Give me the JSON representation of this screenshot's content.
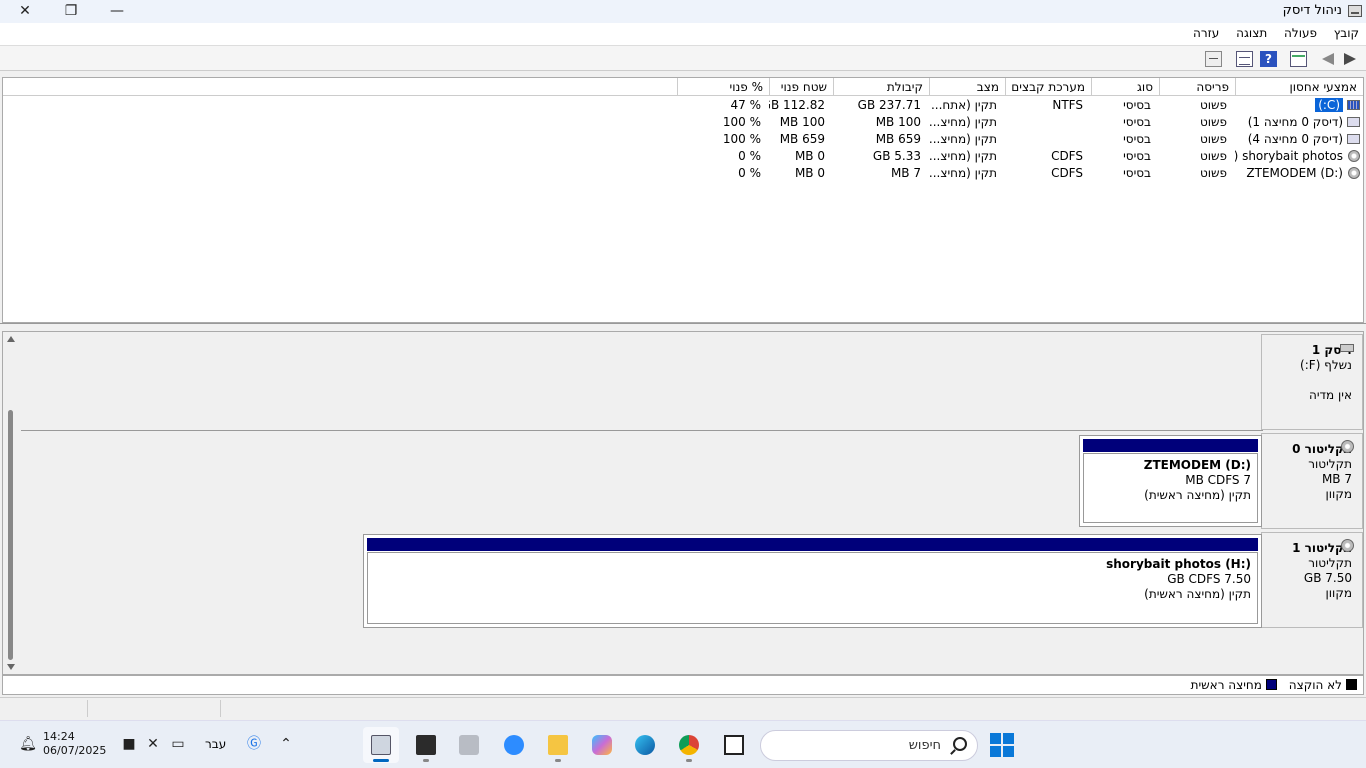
{
  "window": {
    "title": "ניהול דיסק",
    "close_glyph": "✕",
    "max_glyph": "❐",
    "min_glyph": "—"
  },
  "menu": [
    "קובץ",
    "פעולה",
    "תצוגה",
    "עזרה"
  ],
  "toolbar": {
    "help_glyph": "?"
  },
  "volume_list": {
    "columns": [
      "אמצעי אחסון",
      "פריסה",
      "סוג",
      "מערכת קבצים",
      "מצב",
      "קיבולת",
      "שטח פנוי",
      "% פנוי"
    ],
    "rows": [
      {
        "volume": "(C:)",
        "layout": "פשוט",
        "type": "בסיסי",
        "fs": "NTFS",
        "status": "תקין (אתח...",
        "capacity": "GB 237.71",
        "free": "GB 112.82",
        "pct": "% 47",
        "icon": "system-drive-icon",
        "selected": true
      },
      {
        "volume": "(דיסק 0 מחיצה 1)",
        "layout": "פשוט",
        "type": "בסיסי",
        "fs": "",
        "status": "תקין (מחיצ...",
        "capacity": "MB 100",
        "free": "MB 100",
        "pct": "% 100",
        "icon": "drive-icon"
      },
      {
        "volume": "(דיסק 0 מחיצה 4)",
        "layout": "פשוט",
        "type": "בסיסי",
        "fs": "",
        "status": "תקין (מחיצ...",
        "capacity": "MB 659",
        "free": "MB 659",
        "pct": "% 100",
        "icon": "drive-icon"
      },
      {
        "volume": "shorybait photos (...",
        "layout": "פשוט",
        "type": "בסיסי",
        "fs": "CDFS",
        "status": "תקין (מחיצ...",
        "capacity": "GB 5.33",
        "free": "MB 0",
        "pct": "% 0",
        "icon": "cd-drive-icon"
      },
      {
        "volume": "ZTEMODEM (D:)",
        "layout": "פשוט",
        "type": "בסיסי",
        "fs": "CDFS",
        "status": "תקין (מחיצ...",
        "capacity": "MB 7",
        "free": "MB 0",
        "pct": "% 0",
        "icon": "cd-drive-icon"
      }
    ]
  },
  "disks": {
    "disk1": {
      "name": "דיסק 1",
      "line1": "נשלף (F:)",
      "line2": "",
      "line3": "אין מדיה"
    },
    "cdrom0": {
      "name": "תקליטור 0",
      "line1": "תקליטור",
      "line2": "MB 7",
      "line3": "מקוון",
      "partition": {
        "name": "ZTEMODEM  (D:)",
        "size": "MB CDFS 7",
        "status": "תקין (מחיצה ראשית)"
      }
    },
    "cdrom1": {
      "name": "תקליטור 1",
      "line1": "תקליטור",
      "line2": "GB 7.50",
      "line3": "מקוון",
      "partition": {
        "name": "shorybait photos  (H:)",
        "size": "GB CDFS 7.50",
        "status": "תקין (מחיצה ראשית)"
      }
    }
  },
  "legend": {
    "unallocated": {
      "label": "לא הוקצה",
      "color": "#000000"
    },
    "primary": {
      "label": "מחיצה ראשית",
      "color": "#00007a"
    }
  },
  "taskbar": {
    "time": "14:24",
    "date": "06/07/2025",
    "language": "עבר",
    "search_placeholder": "חיפוש",
    "apps": [
      "disk-management-app",
      "terminal-app",
      "printer-app",
      "zoom-app",
      "file-explorer-app",
      "copilot-app",
      "edge-app",
      "chrome-app",
      "task-view-app"
    ]
  },
  "colors": {
    "accent": "#0067c0",
    "partition_header": "#00007a",
    "selection": "#0a64d8"
  }
}
